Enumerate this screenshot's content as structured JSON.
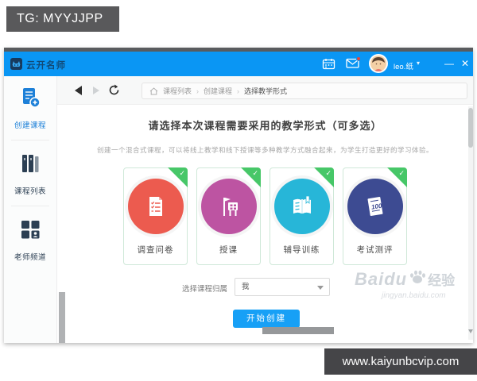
{
  "overlays": {
    "tg_banner": "TG: MYYJJPP",
    "site_banner": "www.kaiyunbcvip.com"
  },
  "titlebar": {
    "app_name": "云开名师",
    "username": "leo.纸",
    "caret": "▾",
    "minimize": "—",
    "close": "✕",
    "color": "#0a96f4"
  },
  "toolbar": {
    "separator": "›",
    "breadcrumb": [
      "课程列表",
      "创建课程",
      "选择教学形式"
    ]
  },
  "sidebar": {
    "active_color": "#1d80d8",
    "inactive_color": "#2c3f53",
    "items": [
      {
        "label": "创建课程",
        "active": true
      },
      {
        "label": "课程列表",
        "active": false
      },
      {
        "label": "老师频道",
        "active": false
      }
    ]
  },
  "main": {
    "title": "请选择本次课程需要采用的教学形式（可多选）",
    "subtitle": "创建一个混合式课程，可以将线上教学和线下授课等多种教学方式融合起来，为学生打造更好的学习体验。",
    "cards": [
      {
        "label": "调查问卷",
        "color": "#ec5b4f"
      },
      {
        "label": "授课",
        "color": "#bd54a2"
      },
      {
        "label": "辅导训练",
        "color": "#27b6d8"
      },
      {
        "label": "考试测评",
        "color": "#3d4b92",
        "icon_text": "100"
      }
    ],
    "check_mark": "✓",
    "check_color": "#47c768",
    "owner_label": "选择课程归属",
    "owner_value": "我",
    "submit_label": "开始创建",
    "submit_color": "#17a0f6"
  },
  "watermark": {
    "brand": "Baidu",
    "suffix": "经验",
    "url": "jingyan.baidu.com"
  }
}
